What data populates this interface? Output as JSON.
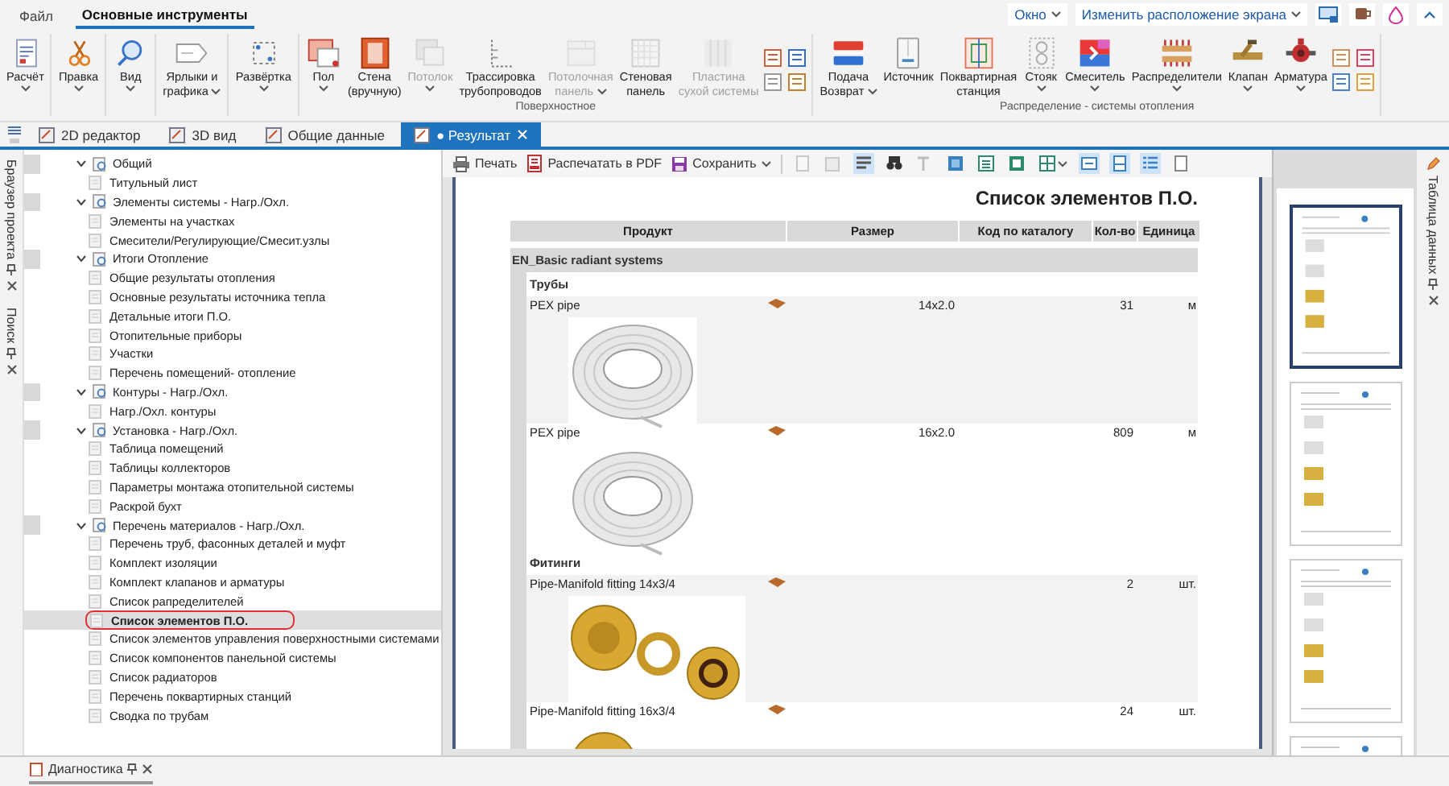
{
  "menu": {
    "tabs": [
      {
        "label": "Файл",
        "selected": false
      },
      {
        "label": "Основные инструменты",
        "selected": true
      }
    ],
    "dropdowns": [
      "Окно",
      "Изменить расположение экрана"
    ]
  },
  "ribbon": {
    "groups": [
      {
        "items": [
          {
            "kind": "menu_below",
            "label": "Расчёт",
            "disabled": false
          }
        ]
      },
      {
        "items": [
          {
            "kind": "menu_below",
            "label": "Правка",
            "disabled": false
          }
        ]
      },
      {
        "items": [
          {
            "kind": "menu_below",
            "label": "Вид",
            "disabled": false
          }
        ]
      },
      {
        "items": [
          {
            "kind": "menu_inline",
            "label": "Ярлыки и\nграфика",
            "disabled": false
          }
        ]
      },
      {
        "items": [
          {
            "kind": "menu_below",
            "label": "Развёртка",
            "disabled": false
          }
        ]
      },
      {
        "label": "Поверхностное",
        "items": [
          {
            "kind": "menu_below",
            "label": "Пол",
            "disabled": false
          },
          {
            "kind": "button",
            "label": "Стена\n(вручную)",
            "disabled": false
          },
          {
            "kind": "menu_below",
            "label": "Потолок",
            "disabled": true
          },
          {
            "kind": "button",
            "label": "Трассировка\nтрубопроводов",
            "disabled": false
          },
          {
            "kind": "menu_inline",
            "label": "Потолочная\nпанель",
            "disabled": true
          },
          {
            "kind": "button",
            "label": "Стеновая\nпанель",
            "disabled": false
          },
          {
            "kind": "button",
            "label": "Пластина\nсухой системы",
            "disabled": true
          },
          {
            "kind": "small"
          }
        ]
      },
      {
        "label": "Распределение - системы отопления",
        "items": [
          {
            "kind": "menu_inline",
            "label": "Подача\nВозврат",
            "disabled": false
          },
          {
            "kind": "button",
            "label": "Источник",
            "disabled": false
          },
          {
            "kind": "button",
            "label": "Поквартирная\nстанция",
            "disabled": false
          },
          {
            "kind": "menu_below",
            "label": "Стояк",
            "disabled": false
          },
          {
            "kind": "menu_below",
            "label": "Смеситель",
            "disabled": false
          },
          {
            "kind": "menu_below",
            "label": "Распределители",
            "disabled": false
          },
          {
            "kind": "menu_below",
            "label": "Клапан",
            "disabled": false
          },
          {
            "kind": "menu_below",
            "label": "Арматура",
            "disabled": false
          },
          {
            "kind": "small"
          }
        ]
      }
    ]
  },
  "doc_tabs": [
    {
      "label": "2D редактор",
      "selected": false
    },
    {
      "label": "3D вид",
      "selected": false
    },
    {
      "label": "Общие данные",
      "selected": false
    },
    {
      "label": "● Результат",
      "selected": true
    }
  ],
  "left_panels": [
    "Браузер проекта",
    "Поиск"
  ],
  "right_panels": [
    "Таблица данных"
  ],
  "bottom_panels": [
    "Диагностика"
  ],
  "tree": [
    {
      "label": "Общий",
      "expanded": true,
      "children": [
        {
          "label": "Титульный лист",
          "selected": false
        }
      ]
    },
    {
      "label": "Элементы системы - Нагр./Охл.",
      "expanded": true,
      "children": [
        {
          "label": "Элементы на участках",
          "selected": false
        },
        {
          "label": "Смесители/Регулирующие/Смесит.узлы",
          "selected": false
        }
      ]
    },
    {
      "label": "Итоги Отопление",
      "expanded": true,
      "children": [
        {
          "label": "Общие результаты отопления",
          "selected": false
        },
        {
          "label": "Основные результаты источника тепла",
          "selected": false
        },
        {
          "label": "Детальные итоги П.О.",
          "selected": false
        },
        {
          "label": "Отопительные приборы",
          "selected": false
        },
        {
          "label": "Участки",
          "selected": false
        },
        {
          "label": "Перечень помещений- отопление",
          "selected": false
        }
      ]
    },
    {
      "label": "Контуры - Нагр./Охл.",
      "expanded": true,
      "children": [
        {
          "label": "Нагр./Охл. контуры",
          "selected": false
        }
      ]
    },
    {
      "label": "Установка - Нагр./Охл.",
      "expanded": true,
      "children": [
        {
          "label": "Таблица помещений",
          "selected": false
        },
        {
          "label": "Таблицы коллекторов",
          "selected": false
        },
        {
          "label": "Параметры монтажа отопительной системы",
          "selected": false
        },
        {
          "label": "Раскрой бухт",
          "selected": false
        }
      ]
    },
    {
      "label": "Перечень материалов - Нагр./Охл.",
      "expanded": true,
      "children": [
        {
          "label": "Перечень труб, фасонных деталей и муфт",
          "selected": false
        },
        {
          "label": "Комплект изоляции",
          "selected": false
        },
        {
          "label": "Комплект клапанов и арматуры",
          "selected": false
        },
        {
          "label": "Список рапределителей",
          "selected": false
        },
        {
          "label": "Список элементов П.О.",
          "selected": true
        },
        {
          "label": "Список элементов управления поверхностными системами",
          "selected": false
        },
        {
          "label": "Список компонентов панельной системы",
          "selected": false
        },
        {
          "label": "Список радиаторов",
          "selected": false
        },
        {
          "label": "Перечень поквартирных станций",
          "selected": false
        },
        {
          "label": "Сводка по трубам",
          "selected": false
        }
      ]
    }
  ],
  "report_toolbar": {
    "actions": [
      {
        "label": "Печать",
        "kind": "print"
      },
      {
        "label": "Распечатать в PDF",
        "kind": "pdf"
      },
      {
        "label": "Сохранить",
        "kind": "save",
        "menu": true
      }
    ],
    "tools": [
      {
        "selected": false,
        "disabled": true
      },
      {
        "selected": false,
        "disabled": true
      },
      {
        "selected": true,
        "disabled": false
      },
      {
        "selected": false,
        "disabled": false
      },
      {
        "selected": false,
        "disabled": true
      },
      {
        "selected": false,
        "disabled": false
      },
      {
        "selected": false,
        "disabled": false
      },
      {
        "selected": false,
        "disabled": false
      },
      {
        "selected": false,
        "disabled": false,
        "menu": true
      },
      {
        "selected": true,
        "disabled": false
      },
      {
        "selected": true,
        "disabled": false
      },
      {
        "selected": true,
        "disabled": false
      },
      {
        "selected": false,
        "disabled": false
      }
    ]
  },
  "report": {
    "title": "Список элементов П.О.",
    "columns": [
      "Продукт",
      "Размер",
      "Код по каталогу",
      "Кол-во",
      "Единица"
    ],
    "section": "EN_Basic radiant systems",
    "groups": [
      {
        "label": "Трубы",
        "rows": [
          {
            "product": "PEX pipe",
            "size": "14x2.0",
            "qty": "31",
            "unit": "м",
            "kind": "coil"
          },
          {
            "product": "PEX pipe",
            "size": "16x2.0",
            "qty": "809",
            "unit": "м",
            "kind": "coil"
          }
        ]
      },
      {
        "label": "Фитинги",
        "rows": [
          {
            "product": "Pipe-Manifold fitting 14x3/4",
            "qty": "2",
            "unit": "шт.",
            "kind": "fitting"
          },
          {
            "product": "Pipe-Manifold fitting 16x3/4",
            "qty": "24",
            "unit": "шт.",
            "kind": "fitting"
          }
        ]
      }
    ]
  },
  "thumbnails": [
    {
      "selected": true
    },
    {
      "selected": false
    },
    {
      "selected": false
    },
    {
      "selected": false
    }
  ]
}
